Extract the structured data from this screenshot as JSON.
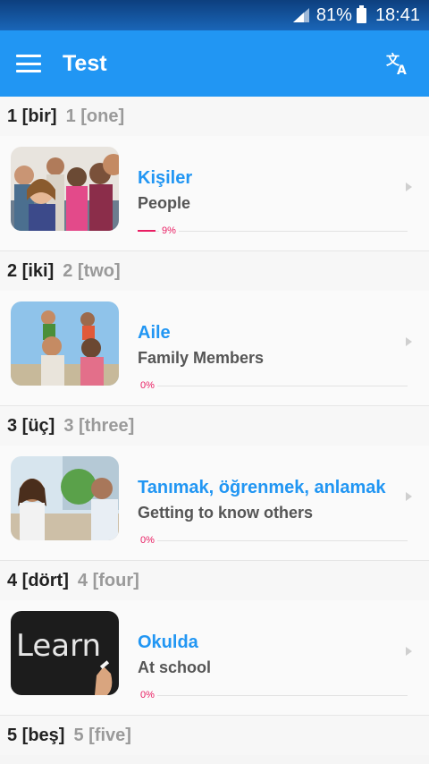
{
  "status_bar": {
    "battery": "81%",
    "time": "18:41"
  },
  "app_bar": {
    "title": "Test",
    "menu_icon": "hamburger-menu-icon",
    "translate_icon": "translate-icon"
  },
  "colors": {
    "primary": "#2196f3",
    "progress": "#e91e63"
  },
  "sections": [
    {
      "tr": "1 [bir]",
      "en": "1 [one]",
      "lesson": {
        "title": "Kişiler",
        "subtitle": "People",
        "progress_text": "9%",
        "progress": 0.09,
        "image": "group-of-people-photo"
      }
    },
    {
      "tr": "2 [iki]",
      "en": "2 [two]",
      "lesson": {
        "title": "Aile",
        "subtitle": "Family Members",
        "progress_text": "0%",
        "progress": 0,
        "image": "family-photo"
      }
    },
    {
      "tr": "3 [üç]",
      "en": "3 [three]",
      "lesson": {
        "title": "Tanımak, öğrenmek, anlamak",
        "subtitle": "Getting to know others",
        "progress_text": "0%",
        "progress": 0,
        "image": "two-people-talking-photo"
      }
    },
    {
      "tr": "4 [dört]",
      "en": "4 [four]",
      "lesson": {
        "title": "Okulda",
        "subtitle": "At school",
        "progress_text": "0%",
        "progress": 0,
        "image": "chalkboard-learn-photo"
      }
    },
    {
      "tr": "5 [beş]",
      "en": "5 [five]"
    }
  ],
  "chalkboard_text": "Learn"
}
